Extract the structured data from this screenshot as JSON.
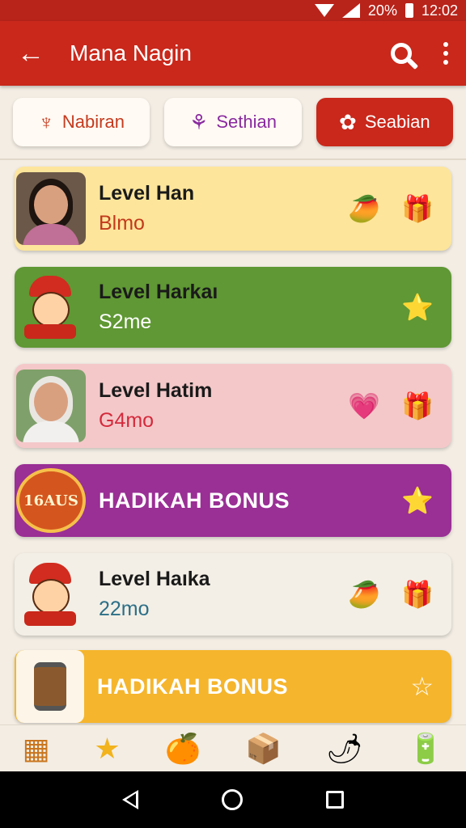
{
  "status_bar": {
    "battery": "20%",
    "time": "12:02"
  },
  "app_bar": {
    "title": "Mana Nagin",
    "back_icon": "arrow-left-icon",
    "search_icon": "search-icon",
    "more_icon": "more-vert-icon"
  },
  "tabs": [
    {
      "label": "Nabiran",
      "icon": "lotus-icon",
      "icon_glyph": "♆",
      "selected": false
    },
    {
      "label": "Sethian",
      "icon": "rose-icon",
      "icon_glyph": "⚘",
      "selected": false
    },
    {
      "label": "Seabian",
      "icon": "flower-bud-icon",
      "icon_glyph": "✿",
      "selected": true
    }
  ],
  "list": [
    {
      "title": "Level Han",
      "subtitle": "Blmo",
      "subtitle_color": "#c23a1c",
      "icons": [
        "mango-icon",
        "gift-icon"
      ],
      "glyphs": [
        "🥭",
        "🎁"
      ]
    },
    {
      "title": "Level Harkaı",
      "subtitle": "S2me",
      "subtitle_color": "#ffffff",
      "icons": [
        "star-icon"
      ],
      "glyphs": [
        "⭐"
      ]
    },
    {
      "title": "Level Hatim",
      "subtitle": "G4mo",
      "subtitle_color": "#d42a3c",
      "icons": [
        "heart-badge-icon",
        "gift-icon"
      ],
      "glyphs": [
        "💗",
        "🎁"
      ]
    },
    {
      "bonus": "HADIKAH BONUS",
      "badge_text": "16AUS",
      "icons": [
        "star-icon"
      ],
      "glyphs": [
        "⭐"
      ]
    },
    {
      "title": "Level Haıka",
      "subtitle": "22mo",
      "subtitle_color": "#2c6f87",
      "icons": [
        "mango-icon",
        "gift-icon"
      ],
      "glyphs": [
        "🥭",
        "🎁"
      ]
    },
    {
      "bonus": "HADIKAH BONUS",
      "icons": [
        "star-icon"
      ],
      "glyphs": [
        "☆"
      ]
    }
  ],
  "bottom_nav": [
    {
      "icon": "grid-icon",
      "glyph": "▦"
    },
    {
      "icon": "star-badge-icon",
      "glyph": "★"
    },
    {
      "icon": "orange-character-icon",
      "glyph": "🍊"
    },
    {
      "icon": "box-icon",
      "glyph": "📦"
    },
    {
      "icon": "pepper-icon",
      "glyph": "🌶"
    },
    {
      "icon": "battery-icon",
      "glyph": "🔋"
    }
  ]
}
